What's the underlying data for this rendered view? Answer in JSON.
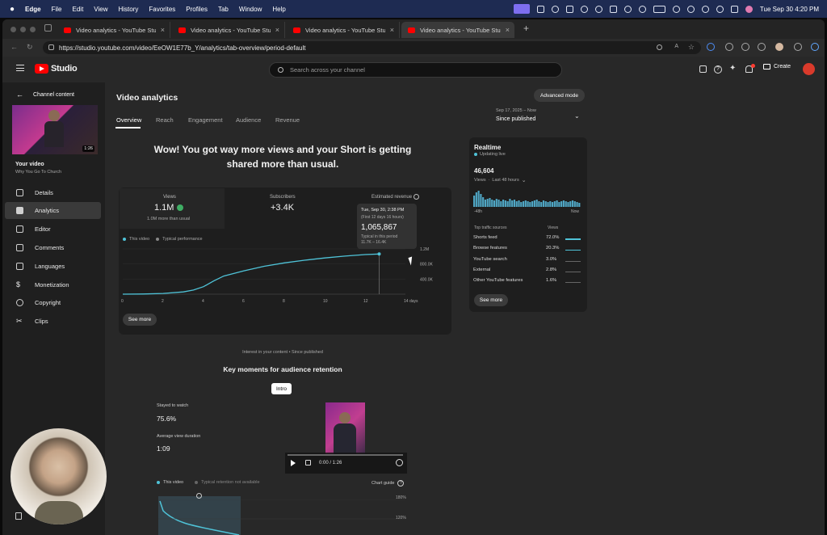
{
  "menubar": {
    "app": "Edge",
    "items": [
      "File",
      "Edit",
      "View",
      "History",
      "Favorites",
      "Profiles",
      "Tab",
      "Window",
      "Help"
    ],
    "clock": "Tue Sep 30  4:20 PM"
  },
  "browser": {
    "tabs": [
      {
        "title": "Video analytics - YouTube Studi"
      },
      {
        "title": "Video analytics - YouTube Studi"
      },
      {
        "title": "Video analytics - YouTube Studi"
      },
      {
        "title": "Video analytics - YouTube Studi"
      }
    ],
    "url": "https://studio.youtube.com/video/EeOW1E77b_Y/analytics/tab-overview/period-default"
  },
  "header": {
    "logo_text": "Studio",
    "search_placeholder": "Search across your channel",
    "create_label": "Create"
  },
  "sidebar": {
    "back_label": "Channel content",
    "thumb_duration": "1:26",
    "your_video_label": "Your video",
    "video_title": "Why You Go To Church",
    "items": [
      {
        "label": "Details",
        "icon": "pencil-icon"
      },
      {
        "label": "Analytics",
        "icon": "bar-chart-icon",
        "active": true
      },
      {
        "label": "Editor",
        "icon": "film-icon"
      },
      {
        "label": "Comments",
        "icon": "comment-icon"
      },
      {
        "label": "Languages",
        "icon": "subtitles-icon"
      },
      {
        "label": "Monetization",
        "icon": "dollar-icon"
      },
      {
        "label": "Copyright",
        "icon": "copyright-icon"
      },
      {
        "label": "Clips",
        "icon": "scissors-icon"
      }
    ]
  },
  "main": {
    "title": "Video analytics",
    "advanced_mode": "Advanced mode",
    "tabs": [
      "Overview",
      "Reach",
      "Engagement",
      "Audience",
      "Revenue"
    ],
    "period_range": "Sep 17, 2025 – Now",
    "period_label": "Since published",
    "headline": "Wow! You got way more views and your Short is getting shared more than usual."
  },
  "stats": {
    "views_label": "Views",
    "views_value": "1.1M",
    "views_sub": "1.0M more than usual",
    "subs_label": "Subscribers",
    "subs_value": "+3.4K",
    "revenue_label": "Estimated revenue",
    "legend_this": "This video",
    "legend_typical": "Typical performance",
    "see_more": "See more"
  },
  "tooltip": {
    "date": "Tue, Sep 30, 2:38 PM",
    "sub": "(First 12 days 16 hours)",
    "value": "1,065,867",
    "typical_label": "Typical in this period",
    "typical_range": "11.7K – 16.4K"
  },
  "chart_data": {
    "type": "line",
    "series": [
      {
        "name": "This video",
        "x": [
          0,
          1,
          2,
          3,
          3.5,
          4,
          4.5,
          5,
          6,
          7,
          8,
          9,
          10,
          11,
          12,
          12.7
        ],
        "y": [
          0,
          5000,
          20000,
          60000,
          110000,
          200000,
          350000,
          480000,
          620000,
          740000,
          830000,
          900000,
          960000,
          1010000,
          1050000,
          1065867
        ]
      }
    ],
    "x_ticks": [
      "0",
      "2",
      "4",
      "6",
      "8",
      "10",
      "12",
      "14 days"
    ],
    "x_tick_values": [
      0,
      2,
      4,
      6,
      8,
      10,
      12,
      14
    ],
    "y_ticks": [
      "1.2M",
      "800.0K",
      "400.0K"
    ],
    "y_tick_values": [
      1200000,
      800000,
      400000
    ],
    "xlim": [
      0,
      14
    ],
    "ylim": [
      0,
      1200000
    ],
    "legend": "top-left"
  },
  "realtime": {
    "title": "Realtime",
    "status": "Updating live",
    "count": "46,604",
    "views_label": "Views",
    "period": "Last 48 hours",
    "start_label": "-48h",
    "end_label": "Now",
    "sources_header": "Top traffic sources",
    "views_header": "Views",
    "sources": [
      {
        "name": "Shorts feed",
        "pct": "72.0%"
      },
      {
        "name": "Browse features",
        "pct": "20.3%"
      },
      {
        "name": "YouTube search",
        "pct": "3.0%"
      },
      {
        "name": "External",
        "pct": "2.8%"
      },
      {
        "name": "Other YouTube features",
        "pct": "1.6%"
      }
    ],
    "see_more": "See more"
  },
  "retention": {
    "interest_line": "Interest in your content • Since published",
    "title": "Key moments for audience retention",
    "intro_chip": "Intro",
    "stayed_label": "Stayed to watch",
    "stayed_value": "75.6%",
    "avd_label": "Average view duration",
    "avd_value": "1:09",
    "player_time": "0:00 / 1:26",
    "legend_this": "This video",
    "legend_typical": "Typical retention not available",
    "chart_guide": "Chart guide",
    "y_top": "180%",
    "y_mid": "120%"
  }
}
